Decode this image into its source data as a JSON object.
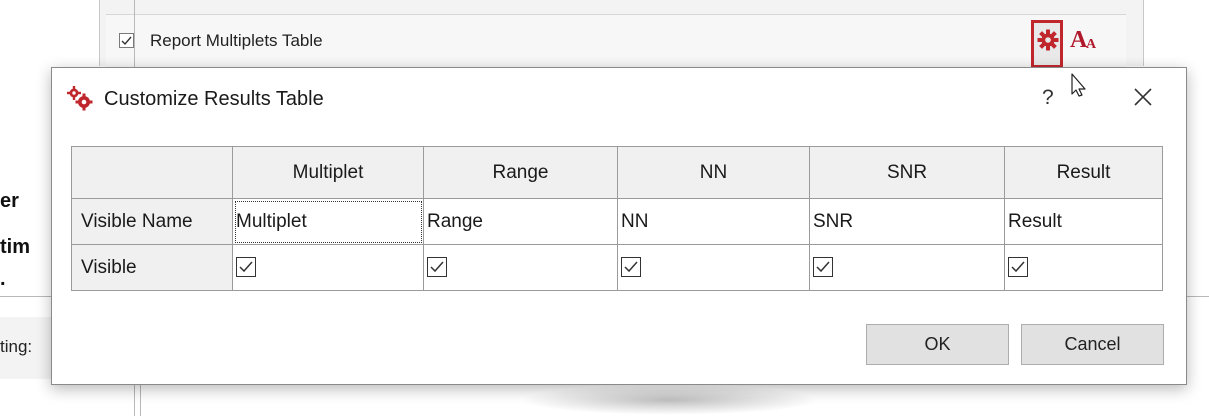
{
  "background": {
    "report_checkbox_label": "Report Multiplets Table",
    "report_checked": true,
    "font_button_big": "A",
    "font_button_small": "A",
    "fragments": [
      "er",
      "tim",
      ".",
      "ting:"
    ]
  },
  "dialog": {
    "title": "Customize Results Table",
    "help_label": "?",
    "close_label": "✕",
    "table": {
      "columns": [
        "Multiplet",
        "Range",
        "NN",
        "SNR",
        "Result"
      ],
      "rows": {
        "visible_name_label": "Visible Name",
        "visible_label": "Visible"
      },
      "visible_names": [
        "Multiplet",
        "Range",
        "NN",
        "SNR",
        "Result"
      ],
      "visible_checked": [
        true,
        true,
        true,
        true,
        true
      ]
    },
    "ok_label": "OK",
    "cancel_label": "Cancel"
  },
  "colors": {
    "accent_red": "#c0272d",
    "dialog_border": "#8a8a8a",
    "header_bg": "#f0f0f0"
  },
  "icons": {
    "gear": "gear-icon",
    "font": "font-size-icon",
    "dialog": "gears-icon",
    "cursor": "mouse-cursor-icon"
  }
}
